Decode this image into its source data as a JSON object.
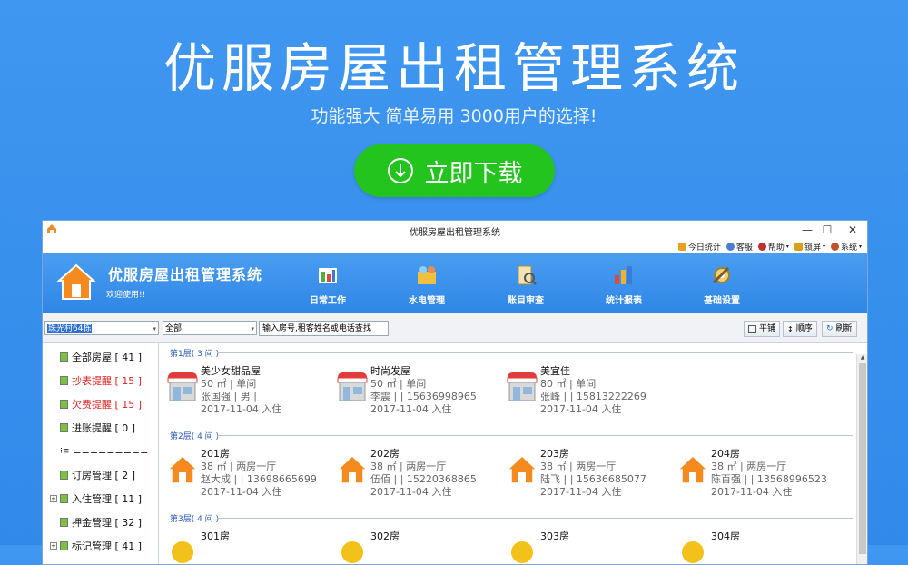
{
  "hero": {
    "title": "优服房屋出租管理系统",
    "subtitle": "功能强大  简单易用  3000用户的选择!",
    "download_label": "立即下载",
    "button_color": "#22c41d"
  },
  "window": {
    "title": "优服房屋出租管理系统",
    "minimize": "—",
    "maximize": "☐",
    "close": "✕",
    "menu": [
      {
        "label": "今日统计",
        "icon": "calendar-icon",
        "color": "#e8a020"
      },
      {
        "label": "客服",
        "icon": "support-icon",
        "color": "#4a7fd0"
      },
      {
        "label": "帮助",
        "icon": "help-icon",
        "color": "#c03030"
      },
      {
        "label": "锁屏",
        "icon": "lock-icon",
        "color": "#d8a018"
      },
      {
        "label": "系统",
        "icon": "gear-icon",
        "color": "#c05030"
      }
    ]
  },
  "banner": {
    "app_name": "优服房屋出租管理系统",
    "welcome": "欢迎使用!!",
    "nav": [
      {
        "label": "日常工作",
        "icon": "daily-work-icon"
      },
      {
        "label": "水电管理",
        "icon": "utility-icon"
      },
      {
        "label": "账目审查",
        "icon": "ledger-icon"
      },
      {
        "label": "统计报表",
        "icon": "report-icon"
      },
      {
        "label": "基础设置",
        "icon": "settings-icon"
      }
    ]
  },
  "toolbar": {
    "building": "珠光村64栋",
    "filter": "全部",
    "search_placeholder": "输入房号,租客姓名或电话查找",
    "btn_tile": "平铺",
    "btn_order": "顺序",
    "btn_refresh": "刷新"
  },
  "sidebar": {
    "items": [
      {
        "label": "全部房屋 [ 41 ]",
        "red": false
      },
      {
        "label": "抄表提醒 [ 15 ]",
        "red": true
      },
      {
        "label": "欠费提醒 [ 15 ]",
        "red": true
      },
      {
        "label": "进账提醒 [ 0 ]",
        "red": false
      },
      {
        "label": "=========",
        "red": false
      },
      {
        "label": "订房管理 [ 2 ]",
        "red": false
      },
      {
        "label": "入住管理 [ 11 ]",
        "red": false
      },
      {
        "label": "押金管理 [ 32 ]",
        "red": false
      },
      {
        "label": "标记管理 [ 41 ]",
        "red": false
      }
    ]
  },
  "floors": [
    {
      "label": "第1层( 3 间 )",
      "rooms": [
        {
          "name": "美少女甜品屋",
          "l2": "50 ㎡ | 单间",
          "l3": "张国强 | 男 |",
          "l4": "2017-11-04 入住",
          "type": "shop"
        },
        {
          "name": "时尚发屋",
          "l2": "50 ㎡ | 单间",
          "l3": "李震 | | 15636998965",
          "l4": "2017-11-04 入住",
          "type": "shop"
        },
        {
          "name": "美宜佳",
          "l2": "80 ㎡ | 单间",
          "l3": "张峰 | | 15813222269",
          "l4": "2017-11-04 入住",
          "type": "shop"
        }
      ]
    },
    {
      "label": "第2层( 4 间 )",
      "rooms": [
        {
          "name": "201房",
          "l2": "38 ㎡ | 两房一厅",
          "l3": "赵大成 | | 13698665699",
          "l4": "2017-11-04 入住",
          "type": "house"
        },
        {
          "name": "202房",
          "l2": "38 ㎡ | 两房一厅",
          "l3": "伍佰 | | 15220368865",
          "l4": "2017-11-04 入住",
          "type": "house"
        },
        {
          "name": "203房",
          "l2": "38 ㎡ | 两房一厅",
          "l3": "陆飞 | | 15636685077",
          "l4": "2017-11-04 入住",
          "type": "house"
        },
        {
          "name": "204房",
          "l2": "38 ㎡ | 两房一厅",
          "l3": "陈百强 | | 13568996523",
          "l4": "2017-11-04 入住",
          "type": "house"
        }
      ]
    },
    {
      "label": "第3层( 4 间 )",
      "rooms": [
        {
          "name": "301房",
          "l2": "",
          "l3": "",
          "l4": "",
          "type": "house"
        },
        {
          "name": "302房",
          "l2": "",
          "l3": "",
          "l4": "",
          "type": "house"
        },
        {
          "name": "303房",
          "l2": "",
          "l3": "",
          "l4": "",
          "type": "house"
        },
        {
          "name": "304房",
          "l2": "",
          "l3": "",
          "l4": "",
          "type": "house"
        }
      ]
    }
  ]
}
